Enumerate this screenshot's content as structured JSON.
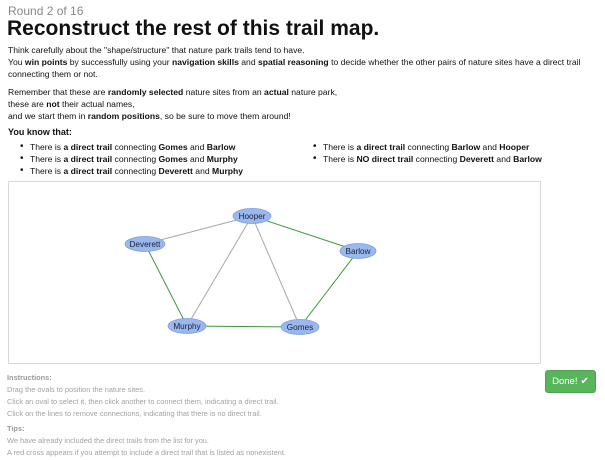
{
  "header": {
    "round": "Round 2 of 16",
    "title": "Reconstruct the rest of this trail map."
  },
  "intro": {
    "p1_line1": {
      "before": "Think carefully about the \"shape/structure\" that nature park trails tend to have."
    },
    "p1_line2": {
      "a": "You ",
      "b1": "win points",
      "c": " by successfully using your ",
      "b2": "navigation skills",
      "d": " and ",
      "b3": "spatial reasoning",
      "e": " to decide whether the other pairs of nature sites have a direct trail connecting them or not."
    },
    "p2_line1": {
      "a": "Remember that these are ",
      "b1": "randomly selected",
      "c": " nature sites from an ",
      "b2": "actual",
      "d": " nature park,"
    },
    "p2_line2": {
      "a": "these are ",
      "b1": "not",
      "c": " their actual names,"
    },
    "p2_line3": {
      "a": "and we start them in ",
      "b1": "random positions",
      "c": ", so be sure to move them around!"
    }
  },
  "facts": {
    "title": "You know that:",
    "left": [
      {
        "pre": "There is ",
        "rel": "a direct trail",
        "mid": " connecting ",
        "a": "Gomes",
        "and": " and ",
        "b": "Barlow"
      },
      {
        "pre": "There is ",
        "rel": "a direct trail",
        "mid": " connecting ",
        "a": "Gomes",
        "and": " and ",
        "b": "Murphy"
      },
      {
        "pre": "There is ",
        "rel": "a direct trail",
        "mid": " connecting ",
        "a": "Deverett",
        "and": " and ",
        "b": "Murphy"
      }
    ],
    "right": [
      {
        "pre": "There is ",
        "rel": "a direct trail",
        "mid": " connecting ",
        "a": "Barlow",
        "and": " and ",
        "b": "Hooper"
      },
      {
        "pre": "There is ",
        "rel": "NO direct trail",
        "mid": " connecting ",
        "a": "Deverett",
        "and": " and ",
        "b": "Barlow"
      }
    ]
  },
  "map": {
    "nodes": {
      "hooper": "Hooper",
      "deverett": "Deverett",
      "barlow": "Barlow",
      "murphy": "Murphy",
      "gomes": "Gomes"
    },
    "edges": [
      {
        "from": "Hooper",
        "to": "Deverett",
        "kind": "user"
      },
      {
        "from": "Hooper",
        "to": "Murphy",
        "kind": "user"
      },
      {
        "from": "Hooper",
        "to": "Gomes",
        "kind": "user"
      },
      {
        "from": "Hooper",
        "to": "Barlow",
        "kind": "known"
      },
      {
        "from": "Deverett",
        "to": "Murphy",
        "kind": "known"
      },
      {
        "from": "Murphy",
        "to": "Gomes",
        "kind": "known"
      },
      {
        "from": "Gomes",
        "to": "Barlow",
        "kind": "known"
      }
    ],
    "colors": {
      "known_trail": "#3a9a3a",
      "user_trail": "#a8a8a8",
      "node_fill": "#99b8ef"
    }
  },
  "done_button": {
    "label": "Done!",
    "icon": "checkmark-icon"
  },
  "help": {
    "instructions_title": "Instructions:",
    "instructions": [
      "Drag the ovals to position the nature sites.",
      "Click an oval to select it, then click another to connect them, indicating a direct trail.",
      "Click on the lines to remove connections, indicating that there is no direct trail."
    ],
    "tips_title": "Tips:",
    "tips": [
      "We have already included the direct trails from the list for you.",
      "A red cross appears if you attempt to include a direct trail that is listed as nonexistent."
    ]
  }
}
